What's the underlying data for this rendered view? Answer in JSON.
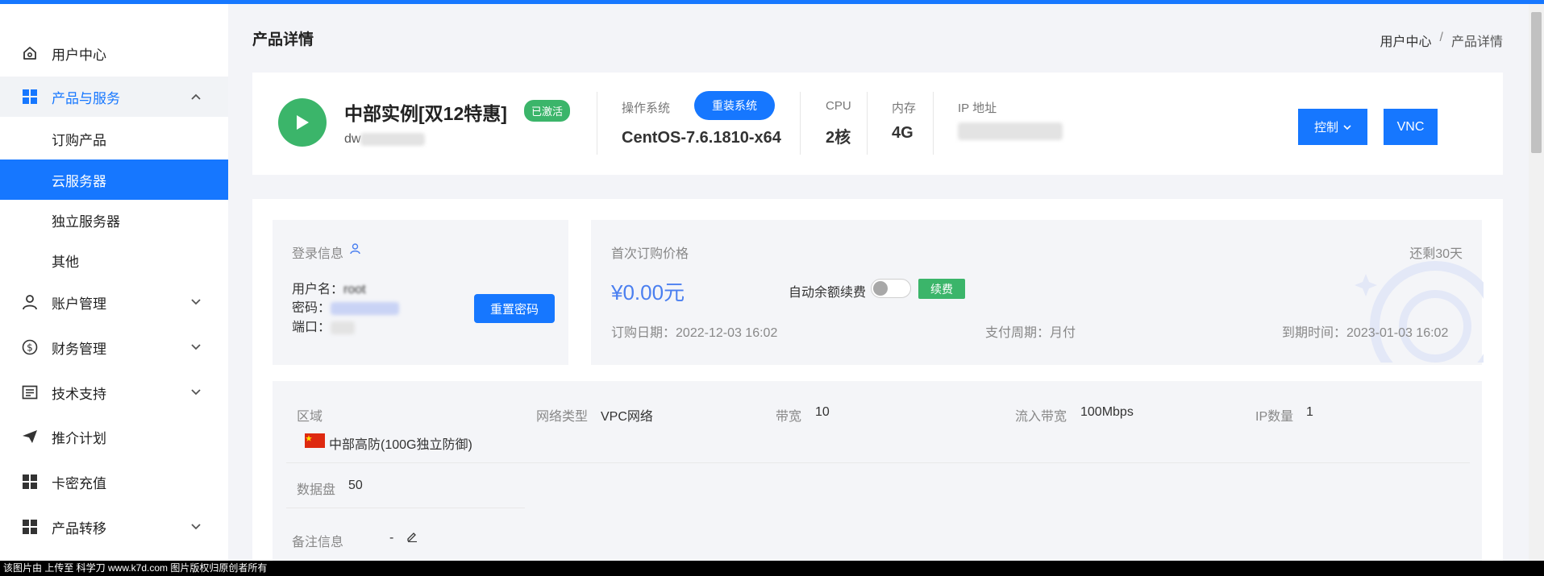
{
  "sidebar": {
    "items": [
      {
        "label": "用户中心",
        "icon": "home-icon"
      },
      {
        "label": "产品与服务",
        "icon": "grid-icon",
        "expanded": true
      },
      {
        "label": "账户管理",
        "icon": "user-icon"
      },
      {
        "label": "财务管理",
        "icon": "dollar-icon"
      },
      {
        "label": "技术支持",
        "icon": "document-icon"
      },
      {
        "label": "推介计划",
        "icon": "send-icon"
      },
      {
        "label": "卡密充值",
        "icon": "grid-icon"
      },
      {
        "label": "产品转移",
        "icon": "grid-icon"
      }
    ],
    "sub_items": [
      "订购产品",
      "云服务器",
      "独立服务器",
      "其他"
    ],
    "active_sub": "云服务器"
  },
  "header": {
    "title": "产品详情",
    "breadcrumb": [
      "用户中心",
      "产品详情"
    ]
  },
  "instance": {
    "name": "中部实例[双12特惠]",
    "status": "已激活",
    "host_prefix": "dw",
    "os_label": "操作系统",
    "reinstall_button": "重装系统",
    "os_value": "CentOS-7.6.1810-x64",
    "cpu_label": "CPU",
    "cpu_value": "2核",
    "mem_label": "内存",
    "mem_value": "4G",
    "ip_label": "IP 地址",
    "control_button": "控制",
    "vnc_button": "VNC"
  },
  "login": {
    "title": "登录信息",
    "username_label": "用户名：",
    "username_value": "root",
    "password_label": "密码：",
    "port_label": "端口：",
    "reset_button": "重置密码"
  },
  "billing": {
    "first_price_label": "首次订购价格",
    "remaining": "还剩30天",
    "price": "¥0.00元",
    "auto_renew_label": "自动余额续费",
    "auto_renew_on": false,
    "renew_button": "续费",
    "order_date_label": "订购日期：",
    "order_date": "2022-12-03 16:02",
    "cycle_label": "支付周期：",
    "cycle": "月付",
    "expire_label": "到期时间：",
    "expire": "2023-01-03 16:02"
  },
  "specs": {
    "region_label": "区域",
    "region_value": "中部高防(100G独立防御)",
    "network_label": "网络类型",
    "network_value": "VPC网络",
    "bandwidth_label": "带宽",
    "bandwidth_value": "10",
    "inbound_label": "流入带宽",
    "inbound_value": "100Mbps",
    "ip_count_label": "IP数量",
    "ip_count_value": "1",
    "disk_label": "数据盘",
    "disk_value": "50",
    "note_label": "备注信息",
    "note_value": "-"
  },
  "footer": "该图片由 上传至 科学刀 www.k7d.com 图片版权归原创者所有",
  "colors": {
    "primary": "#1677ff",
    "success": "#3bb56a",
    "price": "#4a7ff0"
  }
}
